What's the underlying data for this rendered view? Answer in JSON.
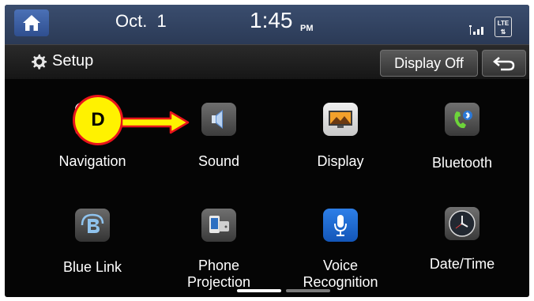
{
  "status_bar": {
    "date": "Oct.  1",
    "time": "1:45",
    "ampm": "PM",
    "network": "LTE"
  },
  "header": {
    "title": "Setup",
    "display_off_label": "Display Off"
  },
  "apps": [
    {
      "id": "navigation",
      "label": "Navigation"
    },
    {
      "id": "sound",
      "label": "Sound"
    },
    {
      "id": "display",
      "label": "Display"
    },
    {
      "id": "bluetooth",
      "label": "Bluetooth"
    },
    {
      "id": "blue-link",
      "label": "Blue Link"
    },
    {
      "id": "phone-projection",
      "label": "Phone Projection"
    },
    {
      "id": "voice-recognition",
      "label": "Voice Recognition"
    },
    {
      "id": "date-time",
      "label": "Date/Time"
    }
  ],
  "callout": {
    "letter": "D",
    "fill_color": "#fff200",
    "border_color": "#e8141b"
  },
  "colors": {
    "status_bar": "#34466a",
    "home_button": "#3d60a3",
    "voice_icon": "#1f6cd4"
  }
}
